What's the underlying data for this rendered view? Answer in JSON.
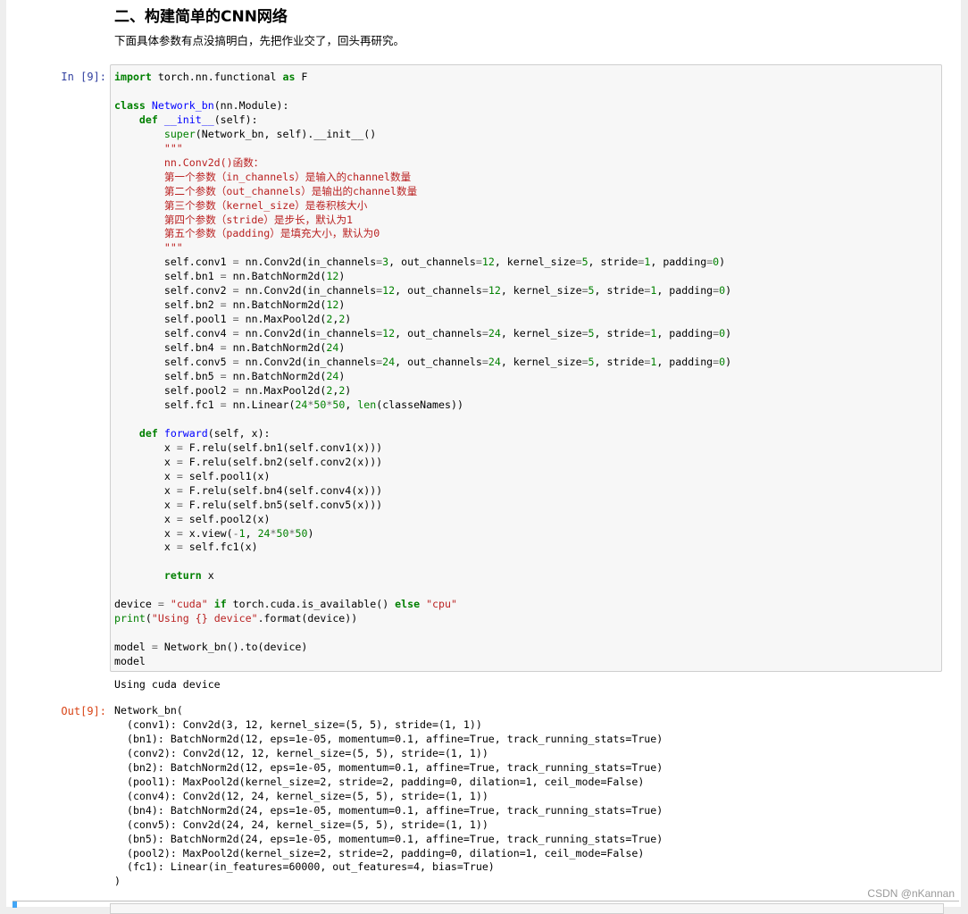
{
  "markdown": {
    "heading": "二、构建简单的CNN网络",
    "paragraph": "下面具体参数有点没搞明白，先把作业交了，回头再研究。"
  },
  "cell": {
    "in_prompt": "In [9]:",
    "out_prompt": "Out[9]:"
  },
  "code_lines": [
    "import torch.nn.functional as F",
    "",
    "class Network_bn(nn.Module):",
    "    def __init__(self):",
    "        super(Network_bn, self).__init__()",
    "        \"\"\"",
    "        nn.Conv2d()函数：",
    "        第一个参数（in_channels）是输入的channel数量",
    "        第二个参数（out_channels）是输出的channel数量",
    "        第三个参数（kernel_size）是卷积核大小",
    "        第四个参数（stride）是步长，默认为1",
    "        第五个参数（padding）是填充大小，默认为0",
    "        \"\"\"",
    "        self.conv1 = nn.Conv2d(in_channels=3, out_channels=12, kernel_size=5, stride=1, padding=0)",
    "        self.bn1 = nn.BatchNorm2d(12)",
    "        self.conv2 = nn.Conv2d(in_channels=12, out_channels=12, kernel_size=5, stride=1, padding=0)",
    "        self.bn2 = nn.BatchNorm2d(12)",
    "        self.pool1 = nn.MaxPool2d(2,2)",
    "        self.conv4 = nn.Conv2d(in_channels=12, out_channels=24, kernel_size=5, stride=1, padding=0)",
    "        self.bn4 = nn.BatchNorm2d(24)",
    "        self.conv5 = nn.Conv2d(in_channels=24, out_channels=24, kernel_size=5, stride=1, padding=0)",
    "        self.bn5 = nn.BatchNorm2d(24)",
    "        self.pool2 = nn.MaxPool2d(2,2)",
    "        self.fc1 = nn.Linear(24*50*50, len(classeNames))",
    "",
    "    def forward(self, x):",
    "        x = F.relu(self.bn1(self.conv1(x)))",
    "        x = F.relu(self.bn2(self.conv2(x)))",
    "        x = self.pool1(x)",
    "        x = F.relu(self.bn4(self.conv4(x)))",
    "        x = F.relu(self.bn5(self.conv5(x)))",
    "        x = self.pool2(x)",
    "        x = x.view(-1, 24*50*50)",
    "        x = self.fc1(x)",
    "",
    "        return x",
    "",
    "device = \"cuda\" if torch.cuda.is_available() else \"cpu\"",
    "print(\"Using {} device\".format(device))",
    "",
    "model = Network_bn().to(device)",
    "model"
  ],
  "stdout": "Using cuda device",
  "output_lines": [
    "Network_bn(",
    "  (conv1): Conv2d(3, 12, kernel_size=(5, 5), stride=(1, 1))",
    "  (bn1): BatchNorm2d(12, eps=1e-05, momentum=0.1, affine=True, track_running_stats=True)",
    "  (conv2): Conv2d(12, 12, kernel_size=(5, 5), stride=(1, 1))",
    "  (bn2): BatchNorm2d(12, eps=1e-05, momentum=0.1, affine=True, track_running_stats=True)",
    "  (pool1): MaxPool2d(kernel_size=2, stride=2, padding=0, dilation=1, ceil_mode=False)",
    "  (conv4): Conv2d(12, 24, kernel_size=(5, 5), stride=(1, 1))",
    "  (bn4): BatchNorm2d(24, eps=1e-05, momentum=0.1, affine=True, track_running_stats=True)",
    "  (conv5): Conv2d(24, 24, kernel_size=(5, 5), stride=(1, 1))",
    "  (bn5): BatchNorm2d(24, eps=1e-05, momentum=0.1, affine=True, track_running_stats=True)",
    "  (pool2): MaxPool2d(kernel_size=2, stride=2, padding=0, dilation=1, ceil_mode=False)",
    "  (fc1): Linear(in_features=60000, out_features=4, bias=True)",
    ")"
  ],
  "watermark": "CSDN @nKannan"
}
